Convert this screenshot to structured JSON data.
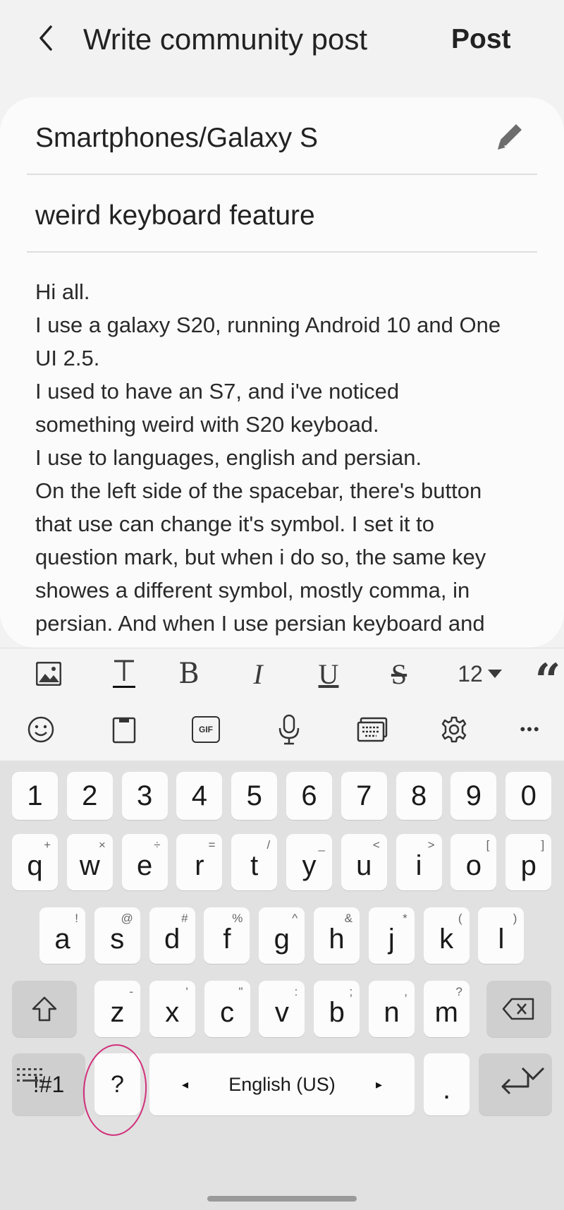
{
  "header": {
    "title": "Write community post",
    "post_label": "Post",
    "back_icon": "back-arrow-icon"
  },
  "post": {
    "category": "Smartphones/Galaxy S",
    "subject": "weird keyboard feature",
    "body_lines": [
      "Hi all.",
      "I use a galaxy S20, running Android 10 and One",
      "UI 2.5.",
      "I used to have an S7, and i've noticed",
      "something weird with S20 keyboad.",
      "I use to languages, english and persian.",
      "On the left side of the spacebar, there's button",
      "that use can change it's symbol. I set it to",
      "question mark, but when i do so, the same key",
      "showes a different symbol, mostly comma, in",
      "persian. And when I use persian keyboard and"
    ]
  },
  "format_toolbar": {
    "items": [
      "image",
      "text-style",
      "bold",
      "italic",
      "underline",
      "strikethrough",
      "font-size",
      "quote"
    ],
    "bold": "B",
    "italic": "I",
    "underline": "U",
    "strike": "S",
    "font_size": "12",
    "quote": "“"
  },
  "keyboard": {
    "toolbar_icons": [
      "emoji-icon",
      "clipboard-icon",
      "gif-icon",
      "microphone-icon",
      "keyboard-mode-icon",
      "settings-icon",
      "more-icon"
    ],
    "gif_label": "GIF",
    "more_label": "•••",
    "numbers": [
      "1",
      "2",
      "3",
      "4",
      "5",
      "6",
      "7",
      "8",
      "9",
      "0"
    ],
    "row1": [
      {
        "k": "q",
        "s": "+"
      },
      {
        "k": "w",
        "s": "×"
      },
      {
        "k": "e",
        "s": "÷"
      },
      {
        "k": "r",
        "s": "="
      },
      {
        "k": "t",
        "s": "/"
      },
      {
        "k": "y",
        "s": "_"
      },
      {
        "k": "u",
        "s": "<"
      },
      {
        "k": "i",
        "s": ">"
      },
      {
        "k": "o",
        "s": "["
      },
      {
        "k": "p",
        "s": "]"
      }
    ],
    "row2": [
      {
        "k": "a",
        "s": "!"
      },
      {
        "k": "s",
        "s": "@"
      },
      {
        "k": "d",
        "s": "#"
      },
      {
        "k": "f",
        "s": "%"
      },
      {
        "k": "g",
        "s": "^"
      },
      {
        "k": "h",
        "s": "&"
      },
      {
        "k": "j",
        "s": "*"
      },
      {
        "k": "k",
        "s": "("
      },
      {
        "k": "l",
        "s": ")"
      }
    ],
    "row3": [
      {
        "k": "z",
        "s": "-"
      },
      {
        "k": "x",
        "s": "'"
      },
      {
        "k": "c",
        "s": "\""
      },
      {
        "k": "v",
        "s": ":"
      },
      {
        "k": "b",
        "s": ";"
      },
      {
        "k": "n",
        "s": ","
      },
      {
        "k": "m",
        "s": "?"
      }
    ],
    "symbols_label": "!#1",
    "custom_key": "?",
    "space_label": "English (US)",
    "period": ".",
    "left_arrow": "◂",
    "right_arrow": "▸"
  }
}
